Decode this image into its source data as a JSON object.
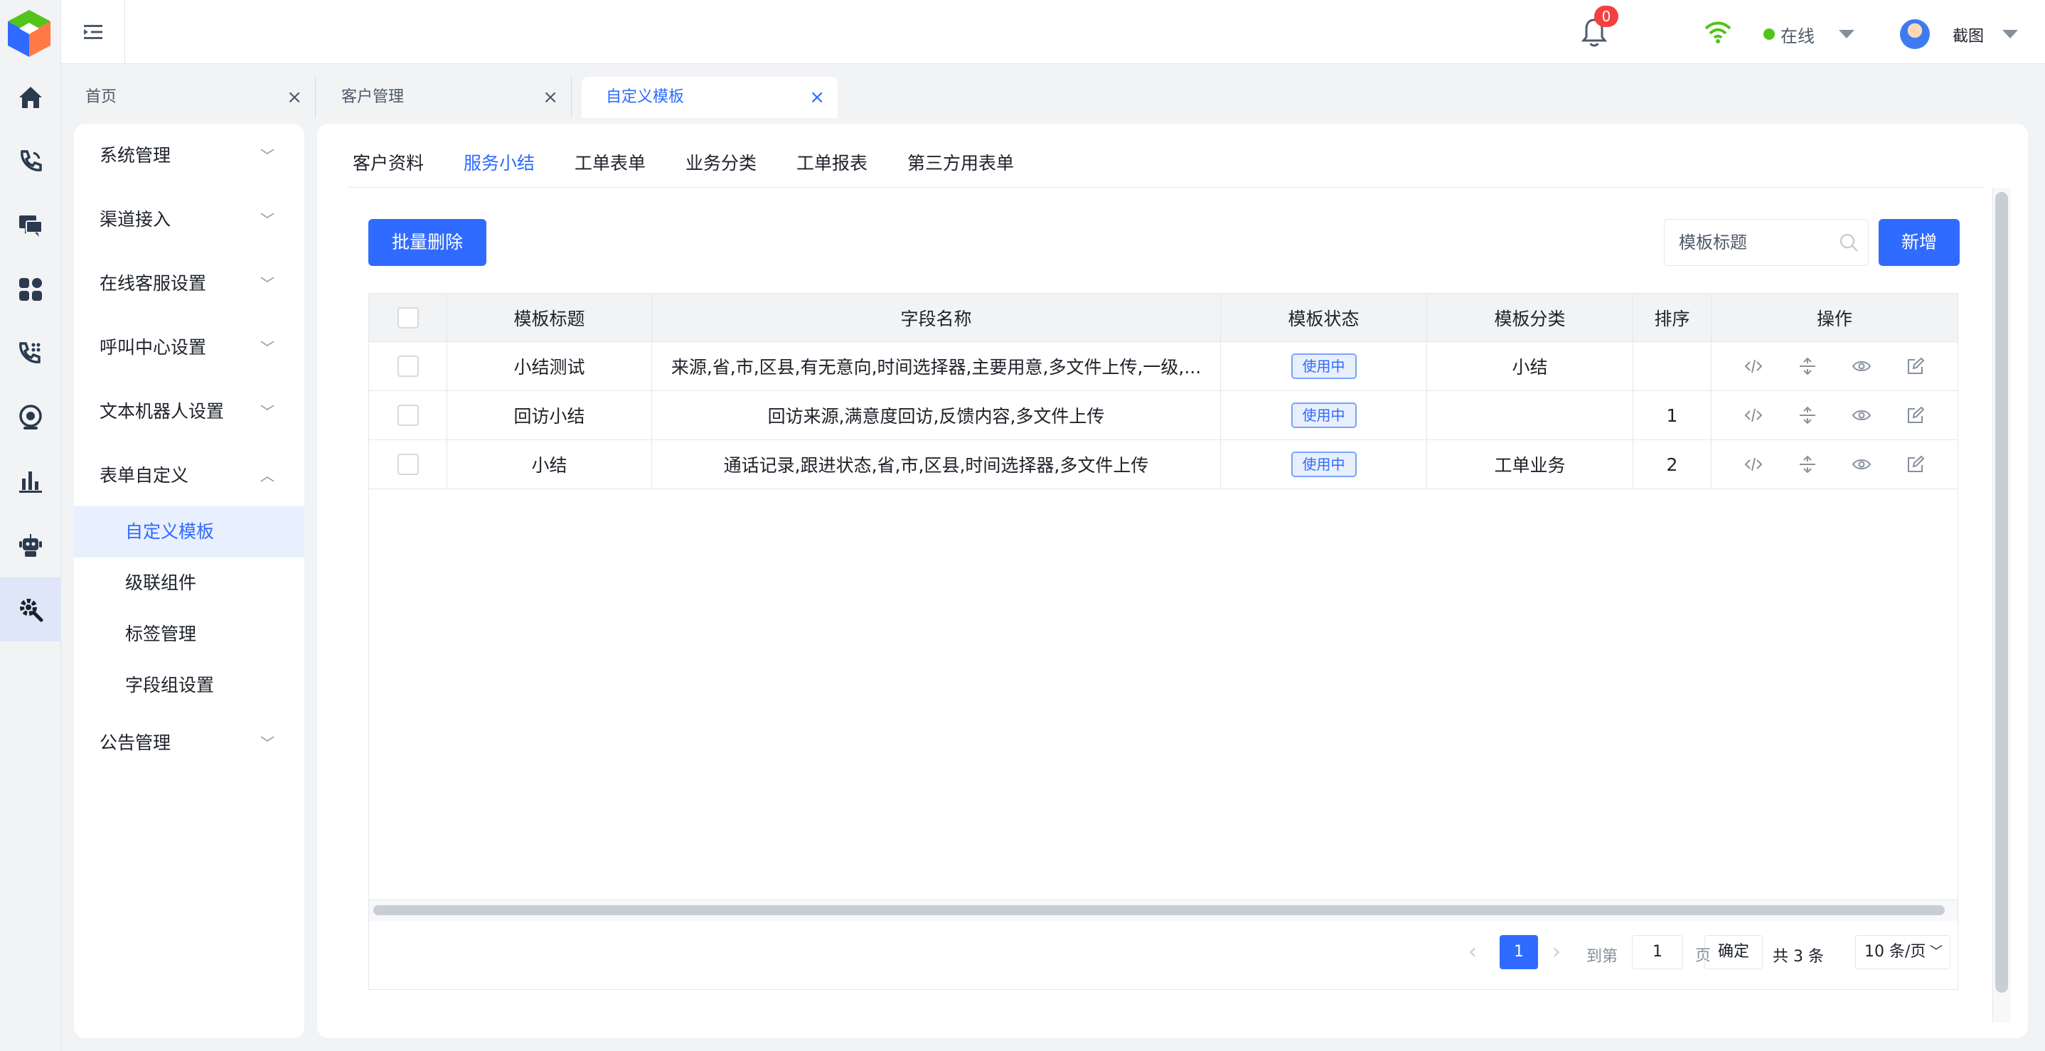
{
  "header": {
    "notification_count": "0",
    "status": "在线",
    "username": "截图"
  },
  "page_tabs": [
    {
      "label": "首页"
    },
    {
      "label": "客户管理"
    },
    {
      "label": "自定义模板"
    }
  ],
  "sidebar": {
    "groups": [
      {
        "label": "系统管理"
      },
      {
        "label": "渠道接入"
      },
      {
        "label": "在线客服设置"
      },
      {
        "label": "呼叫中心设置"
      },
      {
        "label": "文本机器人设置"
      },
      {
        "label": "表单自定义"
      },
      {
        "label": "公告管理"
      }
    ],
    "sub_items": [
      {
        "label": "自定义模板"
      },
      {
        "label": "级联组件"
      },
      {
        "label": "标签管理"
      },
      {
        "label": "字段组设置"
      }
    ]
  },
  "main": {
    "tabs": [
      {
        "label": "客户资料"
      },
      {
        "label": "服务小结"
      },
      {
        "label": "工单表单"
      },
      {
        "label": "业务分类"
      },
      {
        "label": "工单报表"
      },
      {
        "label": "第三方用表单"
      }
    ],
    "batch_delete_label": "批量删除",
    "search_placeholder": "模板标题",
    "add_label": "新增",
    "table": {
      "columns": [
        "模板标题",
        "字段名称",
        "模板状态",
        "模板分类",
        "排序",
        "操作"
      ],
      "rows": [
        {
          "title": "小结测试",
          "fields": "来源,省,市,区县,有无意向,时间选择器,主要用意,多文件上传,一级,...",
          "status": "使用中",
          "category": "小结",
          "order": ""
        },
        {
          "title": "回访小结",
          "fields": "回访来源,满意度回访,反馈内容,多文件上传",
          "status": "使用中",
          "category": "",
          "order": "1"
        },
        {
          "title": "小结",
          "fields": "通话记录,跟进状态,省,市,区县,时间选择器,多文件上传",
          "status": "使用中",
          "category": "工单业务",
          "order": "2"
        }
      ]
    },
    "pagination": {
      "current_page": "1",
      "goto_label": "到第",
      "goto_value": "1",
      "page_unit": "页",
      "confirm_label": "确定",
      "total_label": "共 3 条",
      "page_size_label": "10 条/页"
    }
  },
  "colors": {
    "accent": "#2f6bff",
    "tag_bg": "#e8effd",
    "online": "#52c41a",
    "badge": "#f53f3f"
  }
}
